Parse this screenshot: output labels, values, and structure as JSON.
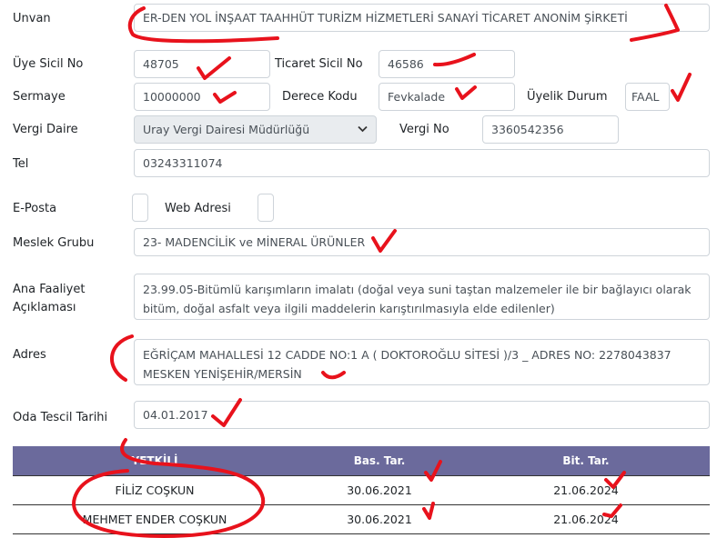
{
  "form": {
    "unvan": {
      "label": "Unvan",
      "value": "ER-DEN YOL İNŞAAT TAAHHÜT TURİZM HİZMETLERİ SANAYİ TİCARET ANONİM ŞİRKETİ"
    },
    "uye_sicil_no": {
      "label": "Üye Sicil No",
      "value": "48705"
    },
    "ticaret_sicil_no": {
      "label": "Ticaret Sicil No",
      "value": "46586"
    },
    "sermaye": {
      "label": "Sermaye",
      "value": "10000000"
    },
    "derece_kodu": {
      "label": "Derece Kodu",
      "value": "Fevkalade"
    },
    "uyelik_durum": {
      "label": "Üyelik Durum",
      "value": "FAAL"
    },
    "vergi_daire": {
      "label": "Vergi Daire",
      "value": "Uray Vergi Dairesi Müdürlüğü"
    },
    "vergi_no": {
      "label": "Vergi No",
      "value": "3360542356"
    },
    "tel": {
      "label": "Tel",
      "value": "03243311074"
    },
    "eposta": {
      "label": "E-Posta",
      "value": ""
    },
    "web_adresi": {
      "label": "Web Adresi",
      "value": ""
    },
    "meslek_grubu": {
      "label": "Meslek Grubu",
      "value": "23- MADENCİLİK ve MİNERAL ÜRÜNLER"
    },
    "ana_faaliyet": {
      "label_line1": "Ana Faaliyet",
      "label_line2": "Açıklaması",
      "value": "23.99.05-Bitümlü karışımların imalatı (doğal veya suni taştan malzemeler ile bir bağlayıcı olarak bitüm, doğal asfalt veya ilgili maddelerin karıştırılmasıyla elde edilenler)"
    },
    "adres": {
      "label": "Adres",
      "value": "EĞRİÇAM MAHALLESİ 12 CADDE NO:1 A ( DOKTOROĞLU SİTESİ )/3 _ ADRES NO: 2278043837 MESKEN YENİŞEHİR/MERSİN"
    },
    "oda_tescil_tarihi": {
      "label": "Oda Tescil Tarihi",
      "value": "04.01.2017"
    }
  },
  "yetkili_table": {
    "headers": [
      "YETKİLİ",
      "Bas. Tar.",
      "Bit. Tar."
    ],
    "rows": [
      {
        "name": "FİLİZ  COŞKUN",
        "bas": "30.06.2021",
        "bit": "21.06.2024"
      },
      {
        "name": "MEHMET ENDER  COŞKUN",
        "bas": "30.06.2021",
        "bit": "21.06.2024"
      }
    ]
  },
  "colors": {
    "annotation_red": "#e8121c",
    "table_header_bg": "#6b6a9c",
    "input_border": "#ced4da",
    "select_bg": "#e9ecef"
  },
  "icons": {
    "select_arrow": "chevron-down-icon"
  }
}
